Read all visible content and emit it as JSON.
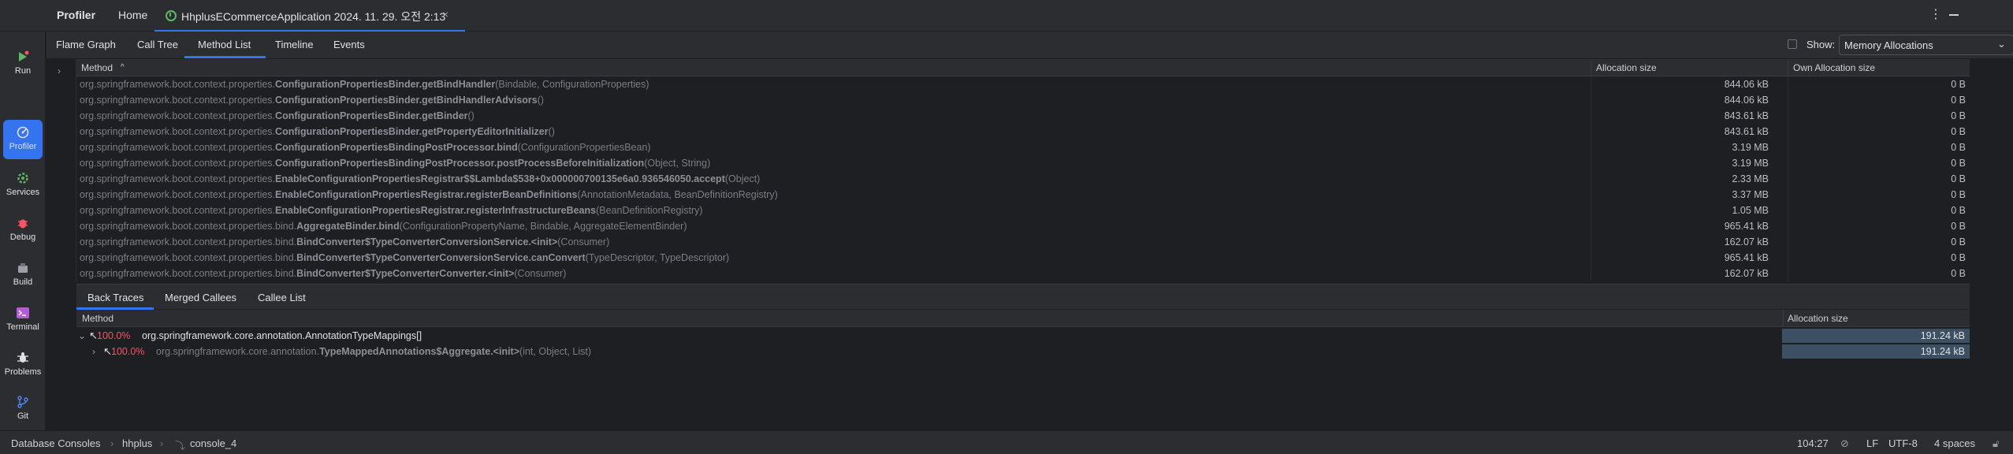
{
  "titlebar": {
    "app_title": "Profiler",
    "home_tab": "Home",
    "session_tab": "HhplusECommerceApplication 2024. 11. 29. 오전 2:13",
    "close_glyph": "×",
    "more_glyph": "⋮",
    "session_icon_color": "#5fb865"
  },
  "toolstrip": {
    "items": [
      {
        "label": "Run",
        "icon": "run-icon"
      },
      {
        "label": "Profiler",
        "icon": "profiler-icon"
      },
      {
        "label": "Services",
        "icon": "services-icon"
      },
      {
        "label": "Debug",
        "icon": "debug-icon"
      },
      {
        "label": "Build",
        "icon": "build-icon"
      },
      {
        "label": "Terminal",
        "icon": "terminal-icon"
      },
      {
        "label": "Problems",
        "icon": "problems-icon"
      },
      {
        "label": "Git",
        "icon": "git-icon"
      }
    ],
    "active_index": 1,
    "accent": "#3574f0"
  },
  "view_tabs": [
    "Flame Graph",
    "Call Tree",
    "Method List",
    "Timeline",
    "Events"
  ],
  "active_view_tab": "Method List",
  "show": {
    "label": "Show:",
    "value": "Memory Allocations"
  },
  "top_table": {
    "headers": {
      "method": "Method",
      "sort_glyph": "^",
      "alloc": "Allocation size",
      "own": "Own Allocation size"
    },
    "rows": [
      {
        "pkg": "org.springframework.boot.context.properties.",
        "cls": "ConfigurationPropertiesBinder.getBindHandler",
        "args": "(Bindable, ConfigurationProperties)",
        "alloc": "844.06 kB",
        "own": "0 B"
      },
      {
        "pkg": "org.springframework.boot.context.properties.",
        "cls": "ConfigurationPropertiesBinder.getBindHandlerAdvisors",
        "args": "()",
        "alloc": "844.06 kB",
        "own": "0 B"
      },
      {
        "pkg": "org.springframework.boot.context.properties.",
        "cls": "ConfigurationPropertiesBinder.getBinder",
        "args": "()",
        "alloc": "843.61 kB",
        "own": "0 B"
      },
      {
        "pkg": "org.springframework.boot.context.properties.",
        "cls": "ConfigurationPropertiesBinder.getPropertyEditorInitializer",
        "args": "()",
        "alloc": "843.61 kB",
        "own": "0 B"
      },
      {
        "pkg": "org.springframework.boot.context.properties.",
        "cls": "ConfigurationPropertiesBindingPostProcessor.bind",
        "args": "(ConfigurationPropertiesBean)",
        "alloc": "3.19 MB",
        "own": "0 B"
      },
      {
        "pkg": "org.springframework.boot.context.properties.",
        "cls": "ConfigurationPropertiesBindingPostProcessor.postProcessBeforeInitialization",
        "args": "(Object, String)",
        "alloc": "3.19 MB",
        "own": "0 B"
      },
      {
        "pkg": "org.springframework.boot.context.properties.",
        "cls": "EnableConfigurationPropertiesRegistrar$$Lambda$538+0x000000700135e6a0.936546050.accept",
        "args": "(Object)",
        "alloc": "2.33 MB",
        "own": "0 B"
      },
      {
        "pkg": "org.springframework.boot.context.properties.",
        "cls": "EnableConfigurationPropertiesRegistrar.registerBeanDefinitions",
        "args": "(AnnotationMetadata, BeanDefinitionRegistry)",
        "alloc": "3.37 MB",
        "own": "0 B"
      },
      {
        "pkg": "org.springframework.boot.context.properties.",
        "cls": "EnableConfigurationPropertiesRegistrar.registerInfrastructureBeans",
        "args": "(BeanDefinitionRegistry)",
        "alloc": "1.05 MB",
        "own": "0 B"
      },
      {
        "pkg": "org.springframework.boot.context.properties.bind.",
        "cls": "AggregateBinder.bind",
        "args": "(ConfigurationPropertyName, Bindable, AggregateElementBinder)",
        "alloc": "965.41 kB",
        "own": "0 B"
      },
      {
        "pkg": "org.springframework.boot.context.properties.bind.",
        "cls": "BindConverter$TypeConverterConversionService.<init>",
        "args": "(Consumer)",
        "alloc": "162.07 kB",
        "own": "0 B"
      },
      {
        "pkg": "org.springframework.boot.context.properties.bind.",
        "cls": "BindConverter$TypeConverterConversionService.canConvert",
        "args": "(TypeDescriptor, TypeDescriptor)",
        "alloc": "965.41 kB",
        "own": "0 B"
      },
      {
        "pkg": "org.springframework.boot.context.properties.bind.",
        "cls": "BindConverter$TypeConverterConverter.<init>",
        "args": "(Consumer)",
        "alloc": "162.07 kB",
        "own": "0 B"
      }
    ]
  },
  "bottom_tabs": [
    "Back Traces",
    "Merged Callees",
    "Callee List"
  ],
  "active_bottom_tab": "Back Traces",
  "bottom_table": {
    "headers": {
      "method": "Method",
      "alloc": "Allocation size"
    },
    "rows": [
      {
        "chev": "⌄",
        "pct": "100.0%",
        "pkg": "org.springframework.core.annotation.",
        "cls": "AnnotationTypeMappings[]",
        "args": "",
        "alloc": "191.24 kB",
        "muted": false,
        "fill": 1.0
      },
      {
        "chev": "›",
        "pct": "100.0%",
        "pkg": "org.springframework.core.annotation.",
        "cls": "TypeMappedAnnotations$Aggregate.<init>",
        "args": "(int, Object, List)",
        "alloc": "191.24 kB",
        "muted": true,
        "fill": 1.0
      }
    ],
    "percent_color": "#f75464",
    "bar_color": "#3d5063"
  },
  "statusbar": {
    "crumbs": [
      "Database Consoles",
      "hhplus",
      "console_4"
    ],
    "position": "104:27",
    "line_sep": "LF",
    "encoding": "UTF-8",
    "indent": "4 spaces"
  }
}
